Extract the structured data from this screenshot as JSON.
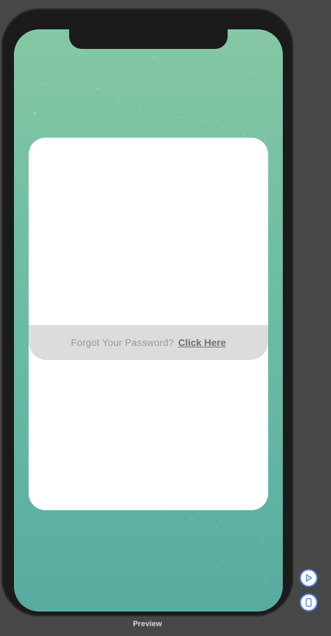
{
  "preview": {
    "label": "Preview"
  },
  "login": {
    "forgot_prompt": "Forgot Your Password?",
    "forgot_link": "Click Here"
  },
  "icons": {
    "play": "play-icon",
    "device": "device-icon"
  },
  "colors": {
    "background": "#474747",
    "accent_blue": "#4a7fd8",
    "gradient_top": "#86c7a5",
    "gradient_bottom": "#58ab9f"
  }
}
